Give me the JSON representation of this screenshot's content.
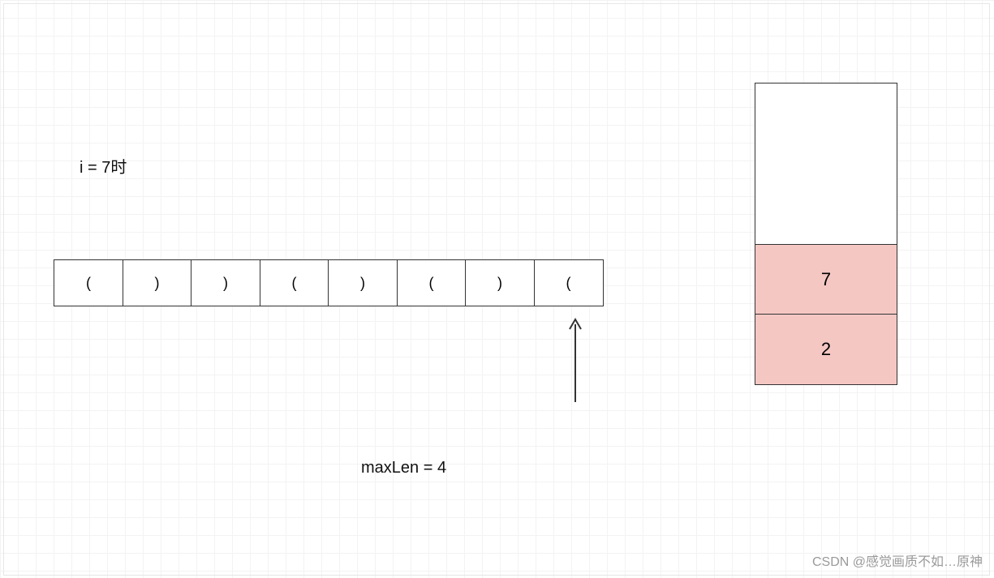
{
  "labels": {
    "i_state": "i = 7时",
    "max_len": "maxLen = 4"
  },
  "array": {
    "cells": [
      "(",
      ")",
      ")",
      "(",
      ")",
      "(",
      ")",
      "("
    ],
    "pointer_index": 7
  },
  "stack": {
    "cells_top_down": [
      "",
      "7",
      "2"
    ],
    "filled_from_bottom": 2
  },
  "watermark": "CSDN @感觉画质不如…原神"
}
